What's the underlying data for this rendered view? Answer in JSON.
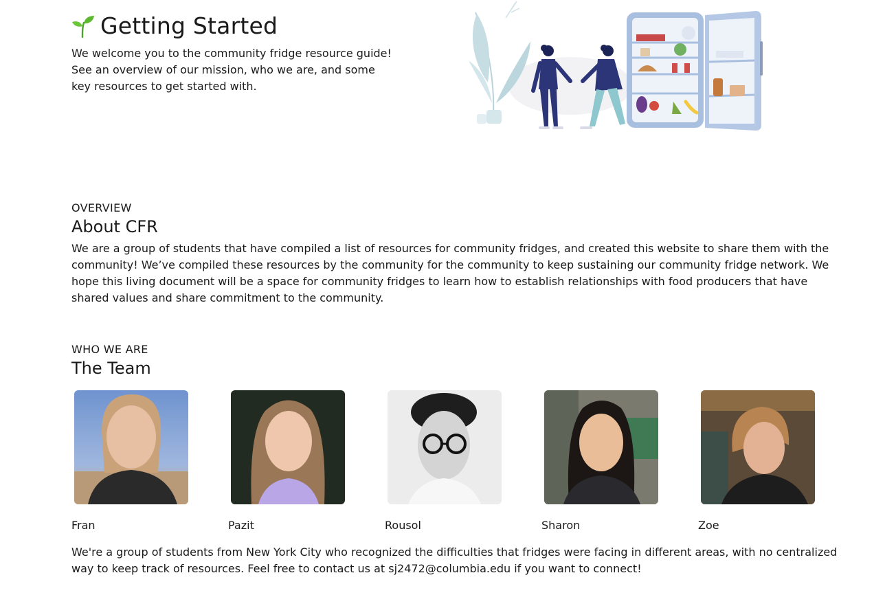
{
  "hero": {
    "title": "Getting Started",
    "intro": "We welcome you to the community fridge resource guide! See an overview of our mission, who we are, and some key resources to get started with.",
    "icon": "sprout-icon",
    "illustration": "fridge-illustration"
  },
  "overview": {
    "eyebrow": "OVERVIEW",
    "title": "About CFR",
    "body": "We are a group of students that have compiled a list of resources for community fridges, and created this website to share them with the community! We’ve compiled these resources by the community for the community to keep sustaining our community fridge network. We hope this living document will be a space for community fridges to learn how to establish relationships with food producers that have shared values and share commitment to the community."
  },
  "team": {
    "eyebrow": "WHO WE ARE",
    "title": "The Team",
    "members": [
      {
        "name": "Fran"
      },
      {
        "name": "Pazit"
      },
      {
        "name": "Rousol"
      },
      {
        "name": "Sharon"
      },
      {
        "name": "Zoe"
      }
    ],
    "body": "We're a group of students from New York City who recognized the difficulties that fridges were facing in different areas, with no centralized way to keep track of resources. Feel free to contact us at sj2472@columbia.edu if you want to connect!"
  },
  "colors": {
    "sprout": "#5cb82e",
    "text": "#1a1a1a",
    "fridge": "#a9bfe0",
    "figure_navy": "#2b3577",
    "figure_teal": "#8fc7cf"
  }
}
